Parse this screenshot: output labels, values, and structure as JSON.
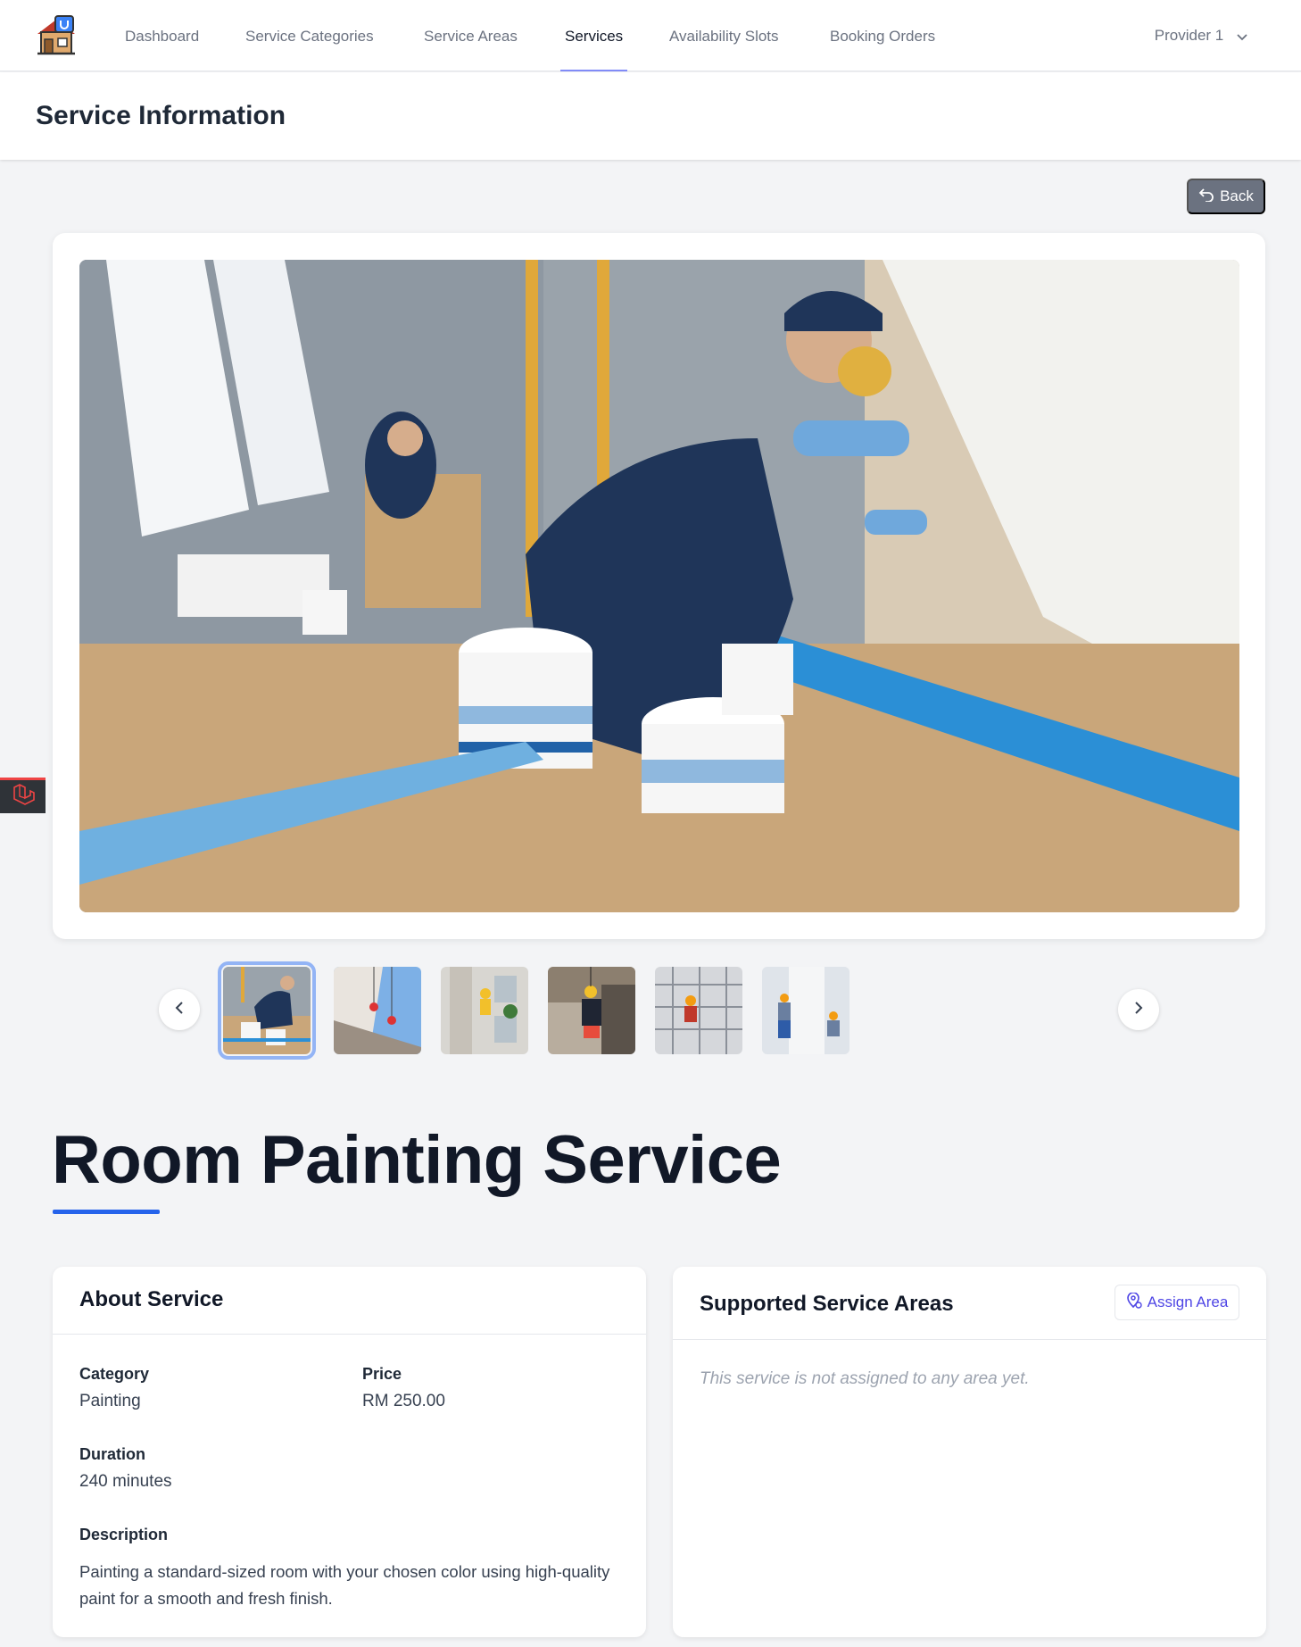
{
  "nav": {
    "items": [
      {
        "label": "Dashboard",
        "active": false
      },
      {
        "label": "Service Categories",
        "active": false
      },
      {
        "label": "Service Areas",
        "active": false
      },
      {
        "label": "Services",
        "active": true
      },
      {
        "label": "Availability Slots",
        "active": false
      },
      {
        "label": "Booking Orders",
        "active": false
      }
    ],
    "user": "Provider 1"
  },
  "header": {
    "title": "Service Information"
  },
  "back_label": "Back",
  "gallery": {
    "main_image": "room-painting-photo",
    "thumbnails": [
      {
        "name": "room-painting-thumb",
        "active": true
      },
      {
        "name": "facade-climbers-thumb",
        "active": false
      },
      {
        "name": "building-painter-thumb",
        "active": false
      },
      {
        "name": "rope-access-thumb",
        "active": false
      },
      {
        "name": "scaffold-painter-thumb",
        "active": false
      },
      {
        "name": "wall-painters-thumb",
        "active": false
      }
    ]
  },
  "service": {
    "name": "Room Painting Service",
    "about": {
      "title": "About Service",
      "category_label": "Category",
      "category": "Painting",
      "price_label": "Price",
      "price": "RM 250.00",
      "duration_label": "Duration",
      "duration": "240 minutes",
      "description_label": "Description",
      "description": "Painting a standard-sized room with your chosen color using high-quality paint for a smooth and fresh finish."
    },
    "areas": {
      "title": "Supported Service Areas",
      "assign_label": "Assign Area",
      "empty": "This service is not assigned to any area yet."
    }
  },
  "colors": {
    "accent": "#2563eb",
    "nav_active": "#818cf8",
    "assign": "#4f46e5",
    "back_bg": "#6b7280"
  }
}
